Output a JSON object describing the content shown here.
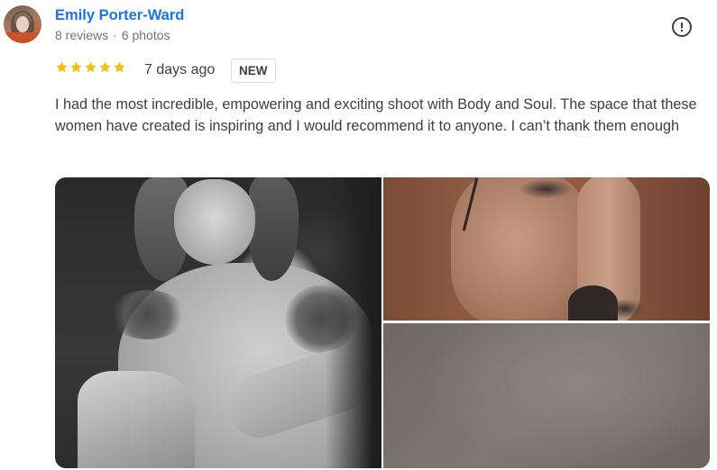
{
  "reviewer": {
    "name": "Emily Porter-Ward",
    "reviews": "8 reviews",
    "separator": "·",
    "photos": "6 photos"
  },
  "rating": {
    "stars": 5,
    "max_stars": 5,
    "star_color": "#fbbc04",
    "age": "7 days ago",
    "badge": "NEW"
  },
  "review_text": "I had the most incredible, empowering and exciting shoot with Body and Soul. The space that these women have created is inspiring and I would recommend it to anyone. I can’t thank them enough",
  "photos": [
    {
      "description_icon": "photo-black-and-white-portrait"
    },
    {
      "description_icon": "photo-tattooed-torso"
    },
    {
      "description_icon": "photo-textured-backdrop"
    }
  ],
  "icons": {
    "report": "report-icon",
    "star": "star-icon"
  },
  "colors": {
    "name_link": "#1a73e8",
    "text": "#3c4043",
    "meta": "#70757a",
    "badge_border": "#dadce0"
  }
}
